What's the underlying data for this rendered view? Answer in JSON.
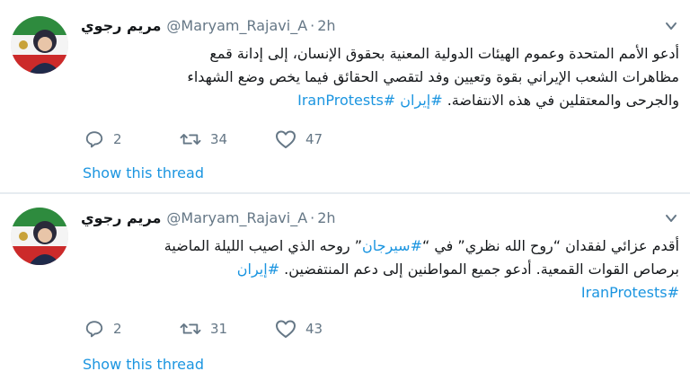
{
  "tweets": [
    {
      "display_name": "مريم رجوي",
      "handle": "@Maryam_Rajavi_A",
      "separator": "·",
      "time": "2h",
      "lines": [
        [
          {
            "t": "أدعو الأمم المتحدة وعموم الهيئات الدولية المعنية بحقوق الإنسان، إلى إدانة قمع"
          }
        ],
        [
          {
            "t": "مظاهرات الشعب الإيراني بقوة وتعيين وفد لتقصي الحقائق فيما يخص وضع الشهداء"
          }
        ],
        [
          {
            "t": "والجرحى والمعتقلين في هذه الانتفاضة. "
          },
          {
            "t": "#إيران",
            "link": true
          },
          {
            "t": " "
          },
          {
            "t": "#IranProtests",
            "link": true
          }
        ]
      ],
      "replies": "2",
      "retweets": "34",
      "likes": "47",
      "show_thread": "Show this thread"
    },
    {
      "display_name": "مريم رجوي",
      "handle": "@Maryam_Rajavi_A",
      "separator": "·",
      "time": "2h",
      "lines": [
        [
          {
            "t": "أقدم عزائي لفقدان “روح الله نظري” في “"
          },
          {
            "t": "#سيرجان",
            "link": true
          },
          {
            "t": "” روحه الذي اصيب الليلة الماضية"
          }
        ],
        [
          {
            "t": "برصاص القوات القمعية. أدعو جميع المواطنين إلى دعم المنتفضين. "
          },
          {
            "t": "#إيران",
            "link": true
          }
        ],
        [
          {
            "t": "#IranProtests",
            "link": true
          }
        ]
      ],
      "replies": "2",
      "retweets": "31",
      "likes": "43",
      "show_thread": "Show this thread"
    }
  ],
  "icons": {
    "reply": "reply-icon",
    "retweet": "retweet-icon",
    "like": "heart-icon",
    "menu": "chevron-down-icon"
  },
  "colors": {
    "link": "#1b95e0",
    "muted": "#657786",
    "text": "#14171a",
    "divider": "#e6ecf0"
  }
}
